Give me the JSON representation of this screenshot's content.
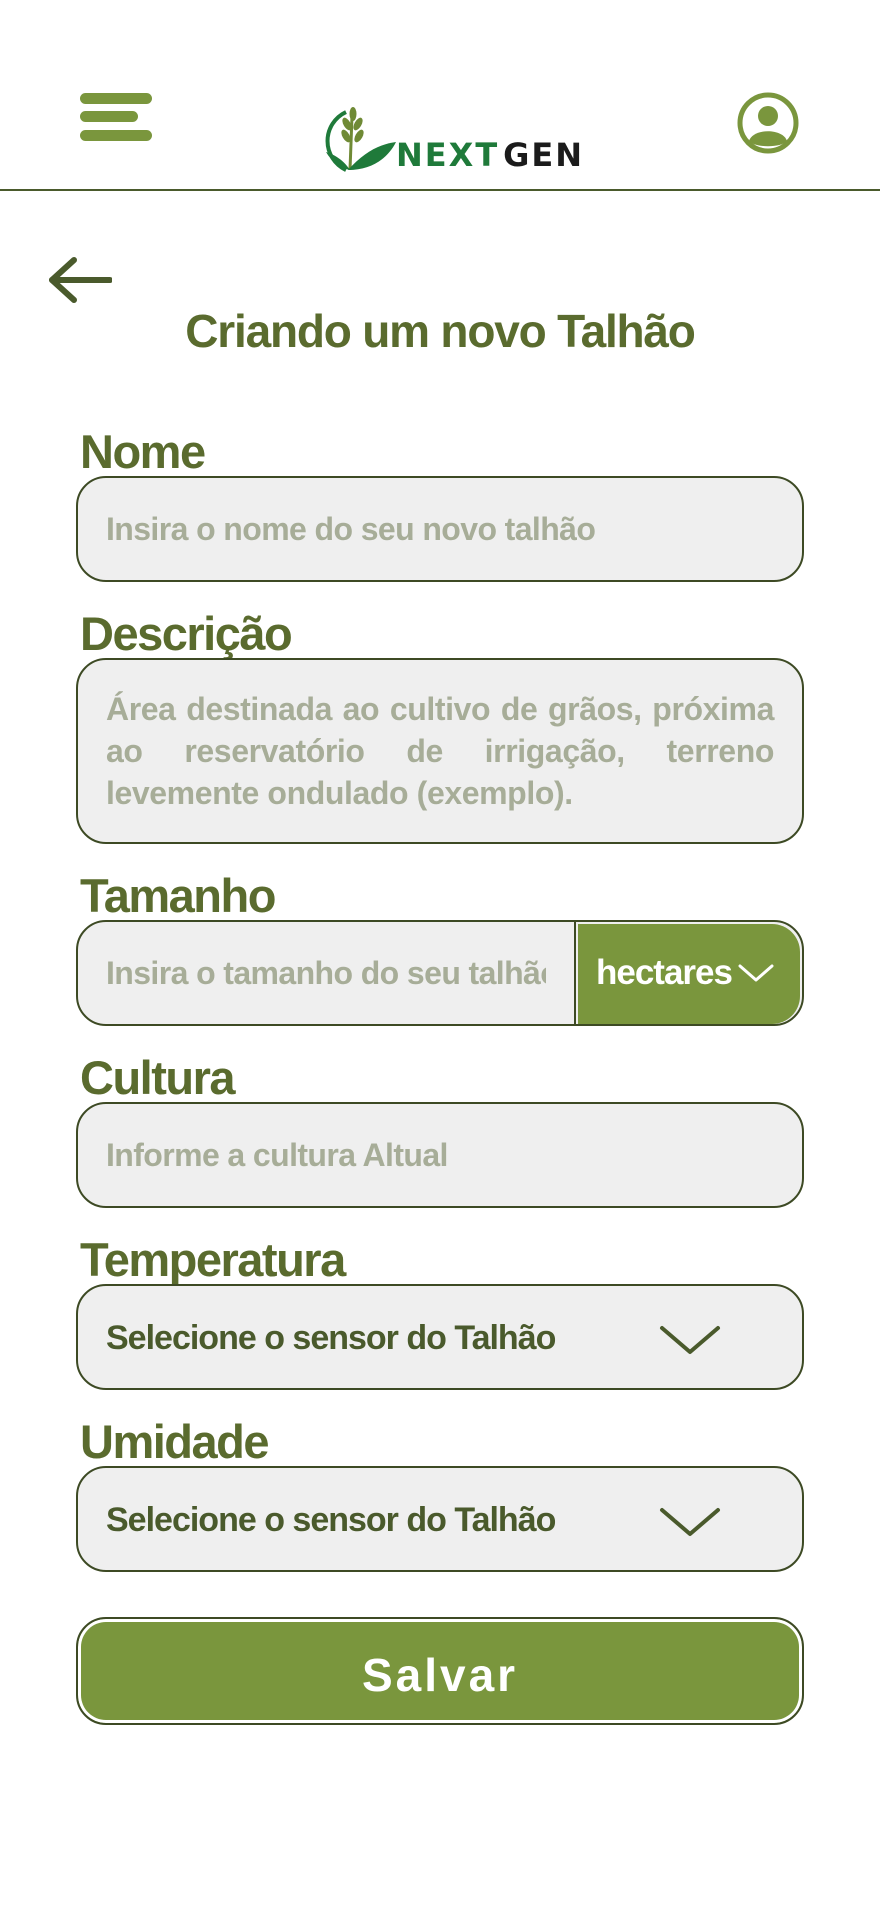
{
  "header": {
    "logo": {
      "part1": "NEXT",
      "part2": "GEN"
    },
    "menu_icon": "hamburger-menu-icon",
    "user_icon": "user-account-icon"
  },
  "colors": {
    "primary": "#7a963d",
    "label": "#5a6b2e",
    "border": "#3d4a24",
    "field_bg": "#efefef",
    "placeholder": "#a7ad98",
    "logo_green": "#1f7a3a"
  },
  "page": {
    "title": "Criando um novo Talhão",
    "back_icon": "arrow-left-icon"
  },
  "form": {
    "nome": {
      "label": "Nome",
      "placeholder": "Insira o nome do seu novo talhão"
    },
    "descricao": {
      "label": "Descrição",
      "placeholder": "Área destinada ao cultivo de grãos, próxima ao reservatório de irrigação, terreno levemente ondulado (exemplo)."
    },
    "tamanho": {
      "label": "Tamanho",
      "placeholder": "Insira o tamanho do seu talhão",
      "unit": "hectares"
    },
    "cultura": {
      "label": "Cultura",
      "placeholder": "Informe a cultura Altual"
    },
    "temperatura": {
      "label": "Temperatura",
      "select": "Selecione o sensor do Talhão"
    },
    "umidade": {
      "label": "Umidade",
      "select": "Selecione o sensor do Talhão"
    },
    "save_label": "Salvar"
  }
}
